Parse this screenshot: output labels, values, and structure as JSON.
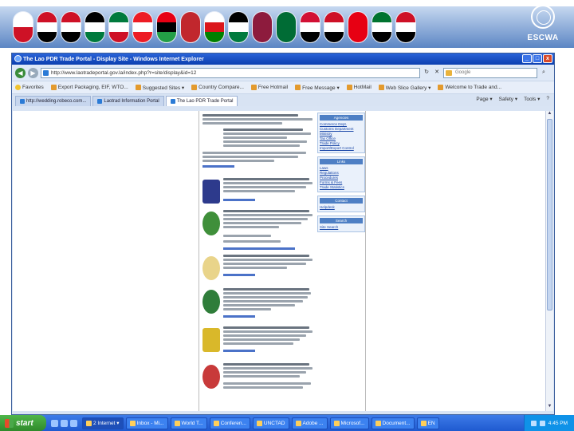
{
  "banner": {
    "org_label": "ESCWA",
    "flags": [
      {
        "name": "bahrain",
        "c": [
          "#ffffff",
          "#ce1126"
        ]
      },
      {
        "name": "egypt",
        "c": [
          "#ce1126",
          "#ffffff",
          "#000000"
        ]
      },
      {
        "name": "iraq",
        "c": [
          "#ce1126",
          "#ffffff",
          "#000000"
        ]
      },
      {
        "name": "jordan",
        "c": [
          "#000000",
          "#ffffff",
          "#007a3d"
        ]
      },
      {
        "name": "kuwait",
        "c": [
          "#007a3d",
          "#ffffff",
          "#ce1126"
        ]
      },
      {
        "name": "lebanon",
        "c": [
          "#ed1c24",
          "#ffffff",
          "#ed1c24"
        ]
      },
      {
        "name": "libya",
        "c": [
          "#e70013",
          "#000000",
          "#239e46"
        ]
      },
      {
        "name": "morocco",
        "c": [
          "#c1272d",
          "#c1272d"
        ]
      },
      {
        "name": "oman",
        "c": [
          "#ffffff",
          "#db161b",
          "#008000"
        ]
      },
      {
        "name": "palestine",
        "c": [
          "#000000",
          "#ffffff",
          "#007a3d"
        ]
      },
      {
        "name": "qatar",
        "c": [
          "#8d1b3d",
          "#8d1b3d"
        ]
      },
      {
        "name": "saudi-arabia",
        "c": [
          "#006c35",
          "#006c35"
        ]
      },
      {
        "name": "sudan",
        "c": [
          "#d21034",
          "#ffffff",
          "#000000"
        ]
      },
      {
        "name": "syria",
        "c": [
          "#ce1126",
          "#ffffff",
          "#000000"
        ]
      },
      {
        "name": "tunisia",
        "c": [
          "#e70013",
          "#e70013"
        ]
      },
      {
        "name": "uae",
        "c": [
          "#00732f",
          "#ffffff",
          "#000000"
        ]
      },
      {
        "name": "yemen",
        "c": [
          "#ce1126",
          "#ffffff",
          "#000000"
        ]
      }
    ]
  },
  "window": {
    "title": "The Lao PDR Trade Portal - Display Site - Windows Internet Explorer",
    "buttons": {
      "minimize": "_",
      "maximize": "□",
      "close": "x"
    }
  },
  "nav": {
    "back": "◀",
    "forward": "▶",
    "address": "http://www.laotradeportal.gov.la/index.php?r=site/display&id=12",
    "search_placeholder": "Google"
  },
  "favorites": [
    {
      "label": "Favorites",
      "star": true
    },
    {
      "label": "Export Packaging, EIF, WTO..."
    },
    {
      "label": "Suggested Sites ▾"
    },
    {
      "label": "Country Compare..."
    },
    {
      "label": "Free Hotmail"
    },
    {
      "label": "Free Message ▾"
    },
    {
      "label": "HotMail"
    },
    {
      "label": "Web Slice Gallery ▾"
    },
    {
      "label": "Welcome to Trade and..."
    }
  ],
  "tabs": [
    {
      "label": "http://wedding.robeco.com...",
      "active": false
    },
    {
      "label": "Laotrad Information Portal",
      "active": false
    },
    {
      "label": "The Lao PDR Trade Portal",
      "active": true
    }
  ],
  "commands": [
    "Page ▾",
    "Safety ▾",
    "Tools ▾",
    "?"
  ],
  "sidebar": {
    "boxes": [
      {
        "title": "Agencies",
        "items": [
          "Commerce Dept.",
          "Customs Department",
          "Ministry",
          "Tax Office",
          "Trade Policy",
          "Import/Export Control"
        ]
      },
      {
        "title": "Links",
        "items": [
          "Laws",
          "Regulations",
          "Procedures",
          "Forms & Fees",
          "Trade Statistics"
        ]
      },
      {
        "title": "Contact",
        "items": [
          "Helpdesk"
        ]
      },
      {
        "title": "Search",
        "items": [
          "Site Search"
        ]
      }
    ]
  },
  "taskbar": {
    "start": "start",
    "tasks": [
      {
        "label": "2 Internet ▾",
        "active": true
      },
      {
        "label": "Inbox - Mi...",
        "active": false
      },
      {
        "label": "World T...",
        "active": false
      },
      {
        "label": "Conferen...",
        "active": false
      },
      {
        "label": "UNCTAD",
        "active": false
      },
      {
        "label": "Adobe ...",
        "active": false
      },
      {
        "label": "Microsof...",
        "active": false
      },
      {
        "label": "Document...",
        "active": false
      },
      {
        "label": "EN",
        "active": false
      }
    ],
    "clock": "4:45 PM"
  }
}
